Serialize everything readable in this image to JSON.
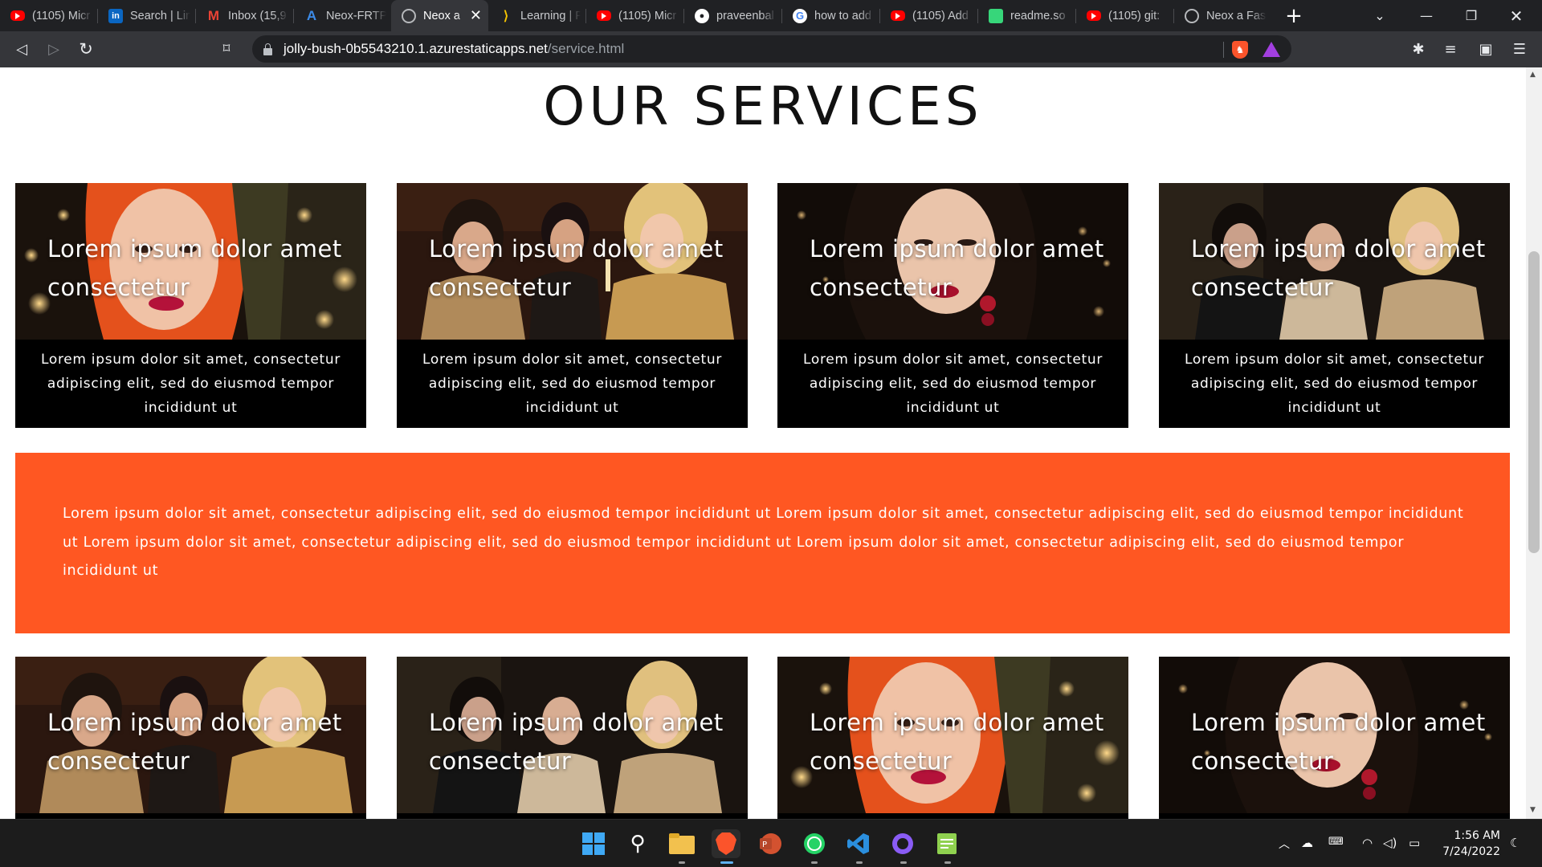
{
  "tabs": [
    {
      "label": "(1105) Micr",
      "icon": "youtube-icon"
    },
    {
      "label": "Search | Lin",
      "icon": "linkedin-icon"
    },
    {
      "label": "Inbox (15,9",
      "icon": "gmail-icon"
    },
    {
      "label": "Neox-FRTP",
      "icon": "azure-icon"
    },
    {
      "label": "Neox a",
      "icon": "globe-icon",
      "active": true
    },
    {
      "label": "Learning | F",
      "icon": "learning-icon"
    },
    {
      "label": "(1105) Micr",
      "icon": "youtube-icon"
    },
    {
      "label": "praveenbal",
      "icon": "github-icon"
    },
    {
      "label": "how to add",
      "icon": "google-icon"
    },
    {
      "label": "(1105) Add",
      "icon": "youtube-icon"
    },
    {
      "label": "readme.so",
      "icon": "readme-icon"
    },
    {
      "label": "(1105) git:",
      "icon": "youtube-icon"
    },
    {
      "label": "Neox a Fasi",
      "icon": "globe-icon"
    }
  ],
  "address_bar": {
    "host": "jolly-bush-0b5543210.1.azurestaticapps.net",
    "path": "/service.html"
  },
  "page": {
    "title": "OUR SERVICES",
    "cards_row1": [
      {
        "heading": "Lorem ipsum dolor amet consectetur",
        "text": "Lorem ipsum dolor sit amet, consectetur adipiscing elit, sed do eiusmod tempor incididunt ut",
        "photo": "redhead-portrait"
      },
      {
        "heading": "Lorem ipsum dolor amet consectetur",
        "text": "Lorem ipsum dolor sit amet, consectetur adipiscing elit, sed do eiusmod tempor incididunt ut",
        "photo": "party-group"
      },
      {
        "heading": "Lorem ipsum dolor amet consectetur",
        "text": "Lorem ipsum dolor sit amet, consectetur adipiscing elit, sed do eiusmod tempor incididunt ut",
        "photo": "brunette-portrait"
      },
      {
        "heading": "Lorem ipsum dolor amet consectetur",
        "text": "Lorem ipsum dolor sit amet, consectetur adipiscing elit, sed do eiusmod tempor incididunt ut",
        "photo": "flapper-group"
      }
    ],
    "banner_text": "Lorem ipsum dolor sit amet, consectetur adipiscing elit, sed do eiusmod tempor incididunt ut Lorem ipsum dolor sit amet, consectetur adipiscing elit, sed do eiusmod tempor incididunt ut Lorem ipsum dolor sit amet, consectetur adipiscing elit, sed do eiusmod tempor incididunt ut Lorem ipsum dolor sit amet, consectetur adipiscing elit, sed do eiusmod tempor incididunt ut",
    "cards_row2": [
      {
        "heading": "Lorem ipsum dolor amet consectetur",
        "photo": "party-group"
      },
      {
        "heading": "Lorem ipsum dolor amet consectetur",
        "photo": "flapper-group"
      },
      {
        "heading": "Lorem ipsum dolor amet consectetur",
        "photo": "redhead-portrait"
      },
      {
        "heading": "Lorem ipsum dolor amet consectetur",
        "photo": "brunette-portrait"
      }
    ]
  },
  "colors": {
    "accent_banner": "#ff5722",
    "card_background": "#000000",
    "browser_frame": "#35363a"
  },
  "taskbar": {
    "apps": [
      "windows-start-icon",
      "search-icon",
      "file-explorer-icon",
      "brave-browser-icon",
      "powerpoint-icon",
      "whatsapp-icon",
      "vscode-icon",
      "github-desktop-icon",
      "notepad-icon"
    ],
    "clock_time": "1:56 AM",
    "clock_date": "7/24/2022"
  }
}
